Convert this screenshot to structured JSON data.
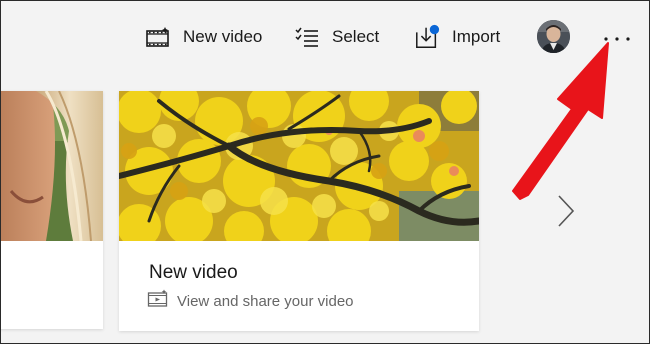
{
  "toolbar": {
    "new_video_label": "New video",
    "select_label": "Select",
    "import_label": "Import",
    "more_label": "..."
  },
  "colors": {
    "import_badge": "#0a66d6",
    "annotation_arrow": "#e8141a"
  },
  "icons": {
    "new_video": "film-icon",
    "select": "checklist-icon",
    "import": "import-icon",
    "more": "more-options-icon",
    "next": "chevron-right-icon"
  },
  "cards": {
    "main": {
      "title": "New video",
      "subtitle": "View and share your video"
    }
  }
}
